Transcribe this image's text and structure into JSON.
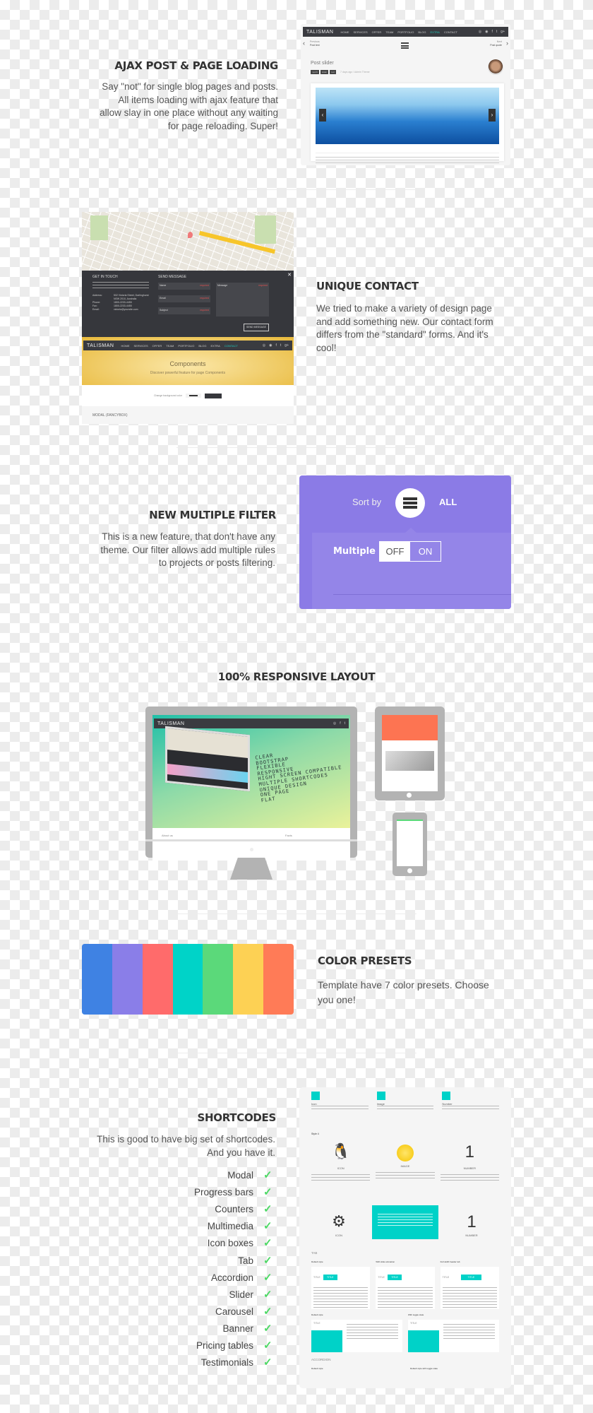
{
  "ajax": {
    "title": "AJAX POST & PAGE LOADING",
    "text": [
      "Say \"not\" for single blog pages and posts.",
      "All items loading with ajax feature that",
      "allow slay in one place without any waiting",
      "for page reloading. Super!"
    ],
    "shot": {
      "logo": "TALISMAN",
      "nav": [
        "HOME",
        "SERVICES",
        "OFFER",
        "TEAM",
        "PORTFOLIO",
        "BLOG",
        "EXTRA",
        "CONTACT"
      ],
      "active": "EXTRA",
      "prev_label": "Previous",
      "prev_title": "Post text",
      "next_label": "Next",
      "next_title": "Post quote",
      "post_title": "Post slider",
      "tags": [
        "mpchl",
        "slider",
        "text"
      ],
      "meta": "7 days ago  /  Admin Theme"
    }
  },
  "contact": {
    "title": "UNIQUE CONTACT",
    "text": [
      "We tried to make a variety of design page",
      "and add something new. Our contact form",
      "differs from the \"standard\" forms. And it's",
      "cool!"
    ],
    "shot": {
      "get_in_touch": "GET IN TOUCH",
      "send_message": "SEND MESSAGE",
      "address_label": "Address:",
      "address": "502 Victoria Street, Darlinghurst NSW 2010, Australia",
      "phone_label": "Phone:",
      "phone": "1800-2233-4455",
      "fax_label": "Fax:",
      "fax": "1800-2233-4455",
      "email_label": "Email:",
      "email": "victoria@yoursite.com",
      "fields": [
        "Name",
        "Email",
        "Subject"
      ],
      "message": "Message",
      "required": "required",
      "send_button": "SEND MESSAGE",
      "logo": "TALISMAN",
      "nav": [
        "HOME",
        "SERVICES",
        "OFFER",
        "TEAM",
        "PORTFOLIO",
        "BLOG",
        "EXTRA",
        "CONTACT"
      ],
      "active": "CONTACT",
      "banner_title": "Components",
      "banner_sub": "Discover powerful feature for page Components",
      "bg_label": "Change background color",
      "modal_label": "MODAL (FANCYBOX)"
    }
  },
  "filter": {
    "title": "NEW  MULTIPLE FILTER",
    "text": [
      "This is a new feature, that don't have any",
      "theme. Our filter allows add multiple rules",
      "to projects  or posts filtering."
    ],
    "sort_by": "Sort by",
    "all": "ALL",
    "multiple": "Multiple",
    "off": "OFF",
    "on": "ON",
    "selected": "OFF",
    "bg": "#8b7be6",
    "panel": "#9485e8"
  },
  "responsive": {
    "title": "100% RESPONSIVE LAYOUT",
    "words": [
      "CLEAR",
      "BOOTSTRAP",
      "FLEXIBLE",
      "RESPONSIVE",
      "HIGHT SCREEN COMPATIBLE",
      "MULTIPLE SHORTCODES",
      "UNIQUE DESIGN",
      "ONE PAGE",
      "FLAT"
    ],
    "about": "About us",
    "facts": "Facts"
  },
  "presets": {
    "title": "COLOR PRESETS",
    "text": [
      "Template have 7 color presets. Choose",
      "you one!"
    ],
    "colors": [
      "#3f82e3",
      "#8a7ee8",
      "#ff6b6b",
      "#00d3c8",
      "#5bd97a",
      "#fdd154",
      "#ff7b57"
    ]
  },
  "shortcodes": {
    "title": "SHORTCODES",
    "text": [
      "This is good to have big set of shortcodes.",
      "And you have it."
    ],
    "items": [
      "Modal",
      "Progress bars",
      "Counters",
      "Multimedia",
      "Icon boxes",
      "Tab",
      "Accordion",
      "Slider",
      "Carousel",
      "Banner",
      "Pricing tables",
      "Testimonials"
    ],
    "shot": {
      "top": [
        "Icon",
        "Image",
        "Number"
      ],
      "style": "Style 4",
      "boxes": [
        "ICON",
        "IMAGE",
        "NUMBER"
      ],
      "num": "1",
      "tab": "TAB",
      "tab_styles": [
        "Default style",
        "With slide animation",
        "Full width header tab"
      ],
      "tab_title": "TITLE",
      "tab_styles2": [
        "Default style",
        "With toggle state"
      ],
      "accordion": "ACCORDION",
      "acc_styles": [
        "Default style",
        "Default style with toggle state"
      ]
    },
    "accent": "#00d2c8"
  }
}
